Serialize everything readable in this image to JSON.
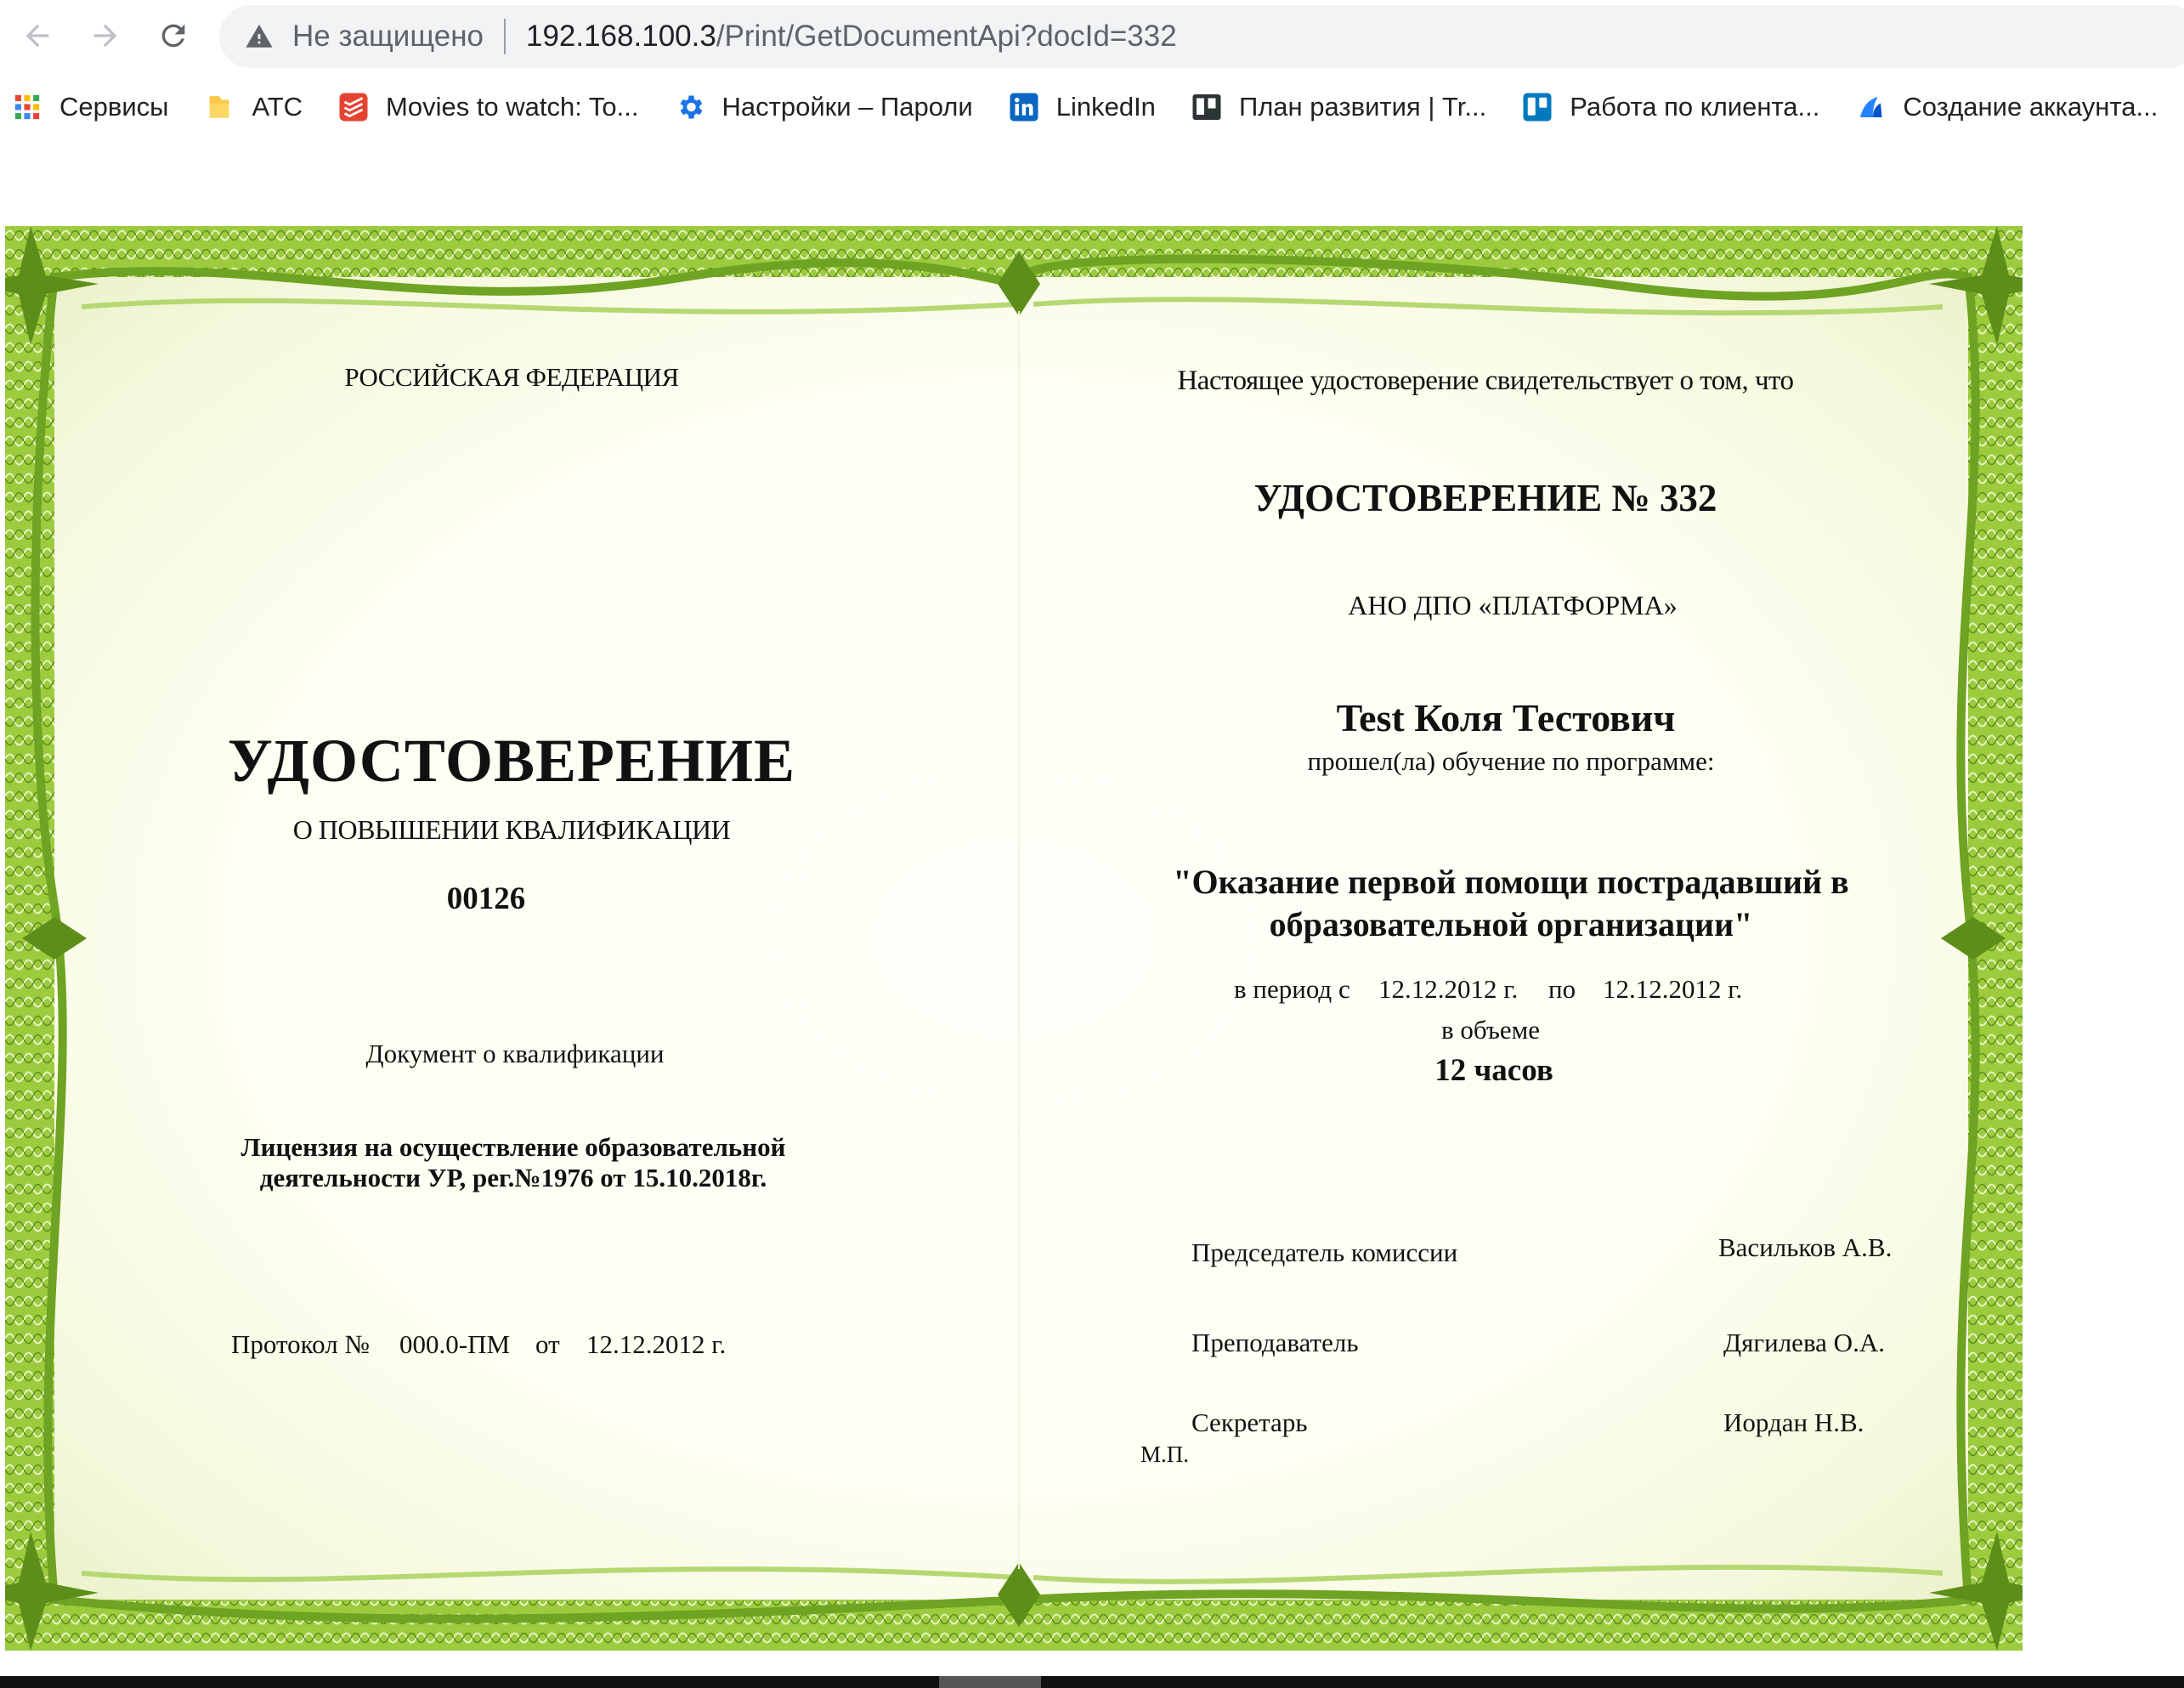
{
  "browser": {
    "security_label": "Не защищено",
    "url_host": "192.168.100.3",
    "url_path": "/Print/GetDocumentApi?docId=332"
  },
  "bookmarks": [
    {
      "label": "Сервисы",
      "icon": "apps-grid-icon"
    },
    {
      "label": "АТС",
      "icon": "folder-icon"
    },
    {
      "label": "Movies to watch: To...",
      "icon": "todoist-icon"
    },
    {
      "label": "Настройки – Пароли",
      "icon": "gear-icon"
    },
    {
      "label": "LinkedIn",
      "icon": "linkedin-icon"
    },
    {
      "label": "План развития | Tr...",
      "icon": "trello-board-icon"
    },
    {
      "label": "Работа по клиента...",
      "icon": "trello-icon"
    },
    {
      "label": "Создание аккаунта...",
      "icon": "atlassian-icon"
    }
  ],
  "colors": {
    "frame_green": "#8fbf2f",
    "frame_light": "#d6e89a",
    "paper": "#fffffa"
  },
  "certificate": {
    "left": {
      "country": "РОССИЙСКАЯ ФЕДЕРАЦИЯ",
      "title": "УДОСТОВЕРЕНИЕ",
      "subtitle": "О ПОВЫШЕНИИ КВАЛИФИКАЦИИ",
      "number": "00126",
      "doc_type": "Документ о квалификации",
      "license_line1": "Лицензия на осуществление образовательной",
      "license_line2": "деятельности УР, рег.№1976 от 15.10.2018г.",
      "protocol_label": "Протокол №",
      "protocol_number": "000.0-ПМ",
      "protocol_from": "от",
      "protocol_date": "12.12.2012 г."
    },
    "right": {
      "intro": "Настоящее удостоверение свидетельствует о том, что",
      "title": "УДОСТОВЕРЕНИЕ №  332",
      "org": "АНО ДПО «ПЛАТФОРМА»",
      "person": "Test Коля Тестович",
      "completed": "прошел(ла) обучение по программе:",
      "program_line1": "\"Оказание первой помощи пострадавший в",
      "program_line2": "образовательной организации\"",
      "period_label": "в период с",
      "date_from": "12.12.2012 г.",
      "period_to": "по",
      "date_to": "12.12.2012 г.",
      "volume_label": "в объеме",
      "hours": "12 часов",
      "chairman_role": "Председатель комиссии",
      "chairman_name": "Васильков А.В.",
      "teacher_role": "Преподаватель",
      "teacher_name": "Дягилева О.А.",
      "secretary_role": "Секретарь",
      "secretary_name": "Иордан Н.В.",
      "stamp": "М.П."
    }
  }
}
